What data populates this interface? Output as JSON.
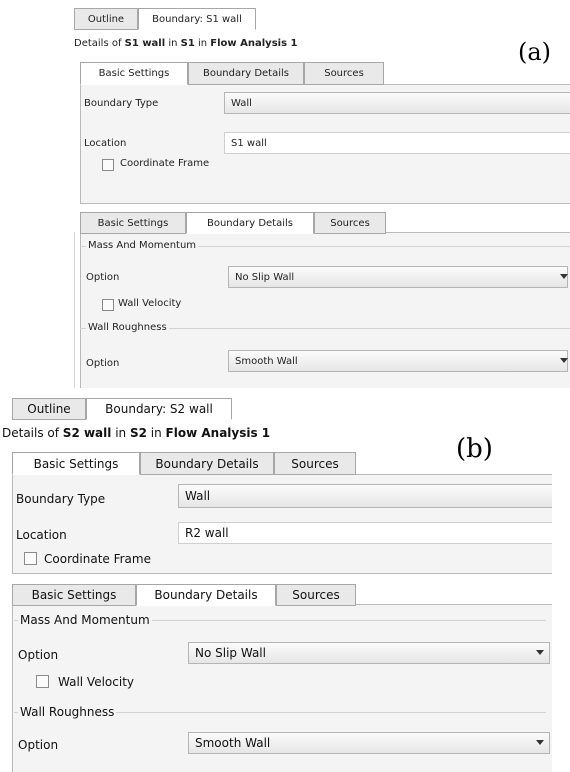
{
  "panel_a": {
    "tabs": [
      "Outline",
      "Boundary: S1 wall"
    ],
    "details": {
      "prefix": "Details of ",
      "object": "S1 wall",
      "mid": " in ",
      "domain": "S1",
      "mid2": " in ",
      "analysis": "Flow Analysis 1"
    },
    "caption": "(a)",
    "top": {
      "tabs": [
        "Basic Settings",
        "Boundary Details",
        "Sources"
      ],
      "boundary_type_label": "Boundary Type",
      "boundary_type_value": "Wall",
      "location_label": "Location",
      "location_value": "S1 wall",
      "coordinate_frame_label": "Coordinate Frame"
    },
    "bottom": {
      "tabs": [
        "Basic Settings",
        "Boundary Details",
        "Sources"
      ],
      "mass_momentum_label": "Mass And Momentum",
      "option1_label": "Option",
      "option1_value": "No Slip Wall",
      "wall_velocity_label": "Wall Velocity",
      "wall_roughness_label": "Wall Roughness",
      "option2_label": "Option",
      "option2_value": "Smooth Wall"
    }
  },
  "panel_b": {
    "tabs": [
      "Outline",
      "Boundary: S2 wall"
    ],
    "details": {
      "prefix": "Details of ",
      "object": "S2 wall",
      "mid": " in ",
      "domain": "S2",
      "mid2": " in ",
      "analysis": "Flow Analysis 1"
    },
    "caption": "(b)",
    "top": {
      "tabs": [
        "Basic Settings",
        "Boundary Details",
        "Sources"
      ],
      "boundary_type_label": "Boundary Type",
      "boundary_type_value": "Wall",
      "location_label": "Location",
      "location_value": "R2 wall",
      "coordinate_frame_label": "Coordinate Frame"
    },
    "bottom": {
      "tabs": [
        "Basic Settings",
        "Boundary Details",
        "Sources"
      ],
      "mass_momentum_label": "Mass And Momentum",
      "option1_label": "Option",
      "option1_value": "No Slip Wall",
      "wall_velocity_label": "Wall Velocity",
      "wall_roughness_label": "Wall Roughness",
      "option2_label": "Option",
      "option2_value": "Smooth Wall"
    }
  }
}
